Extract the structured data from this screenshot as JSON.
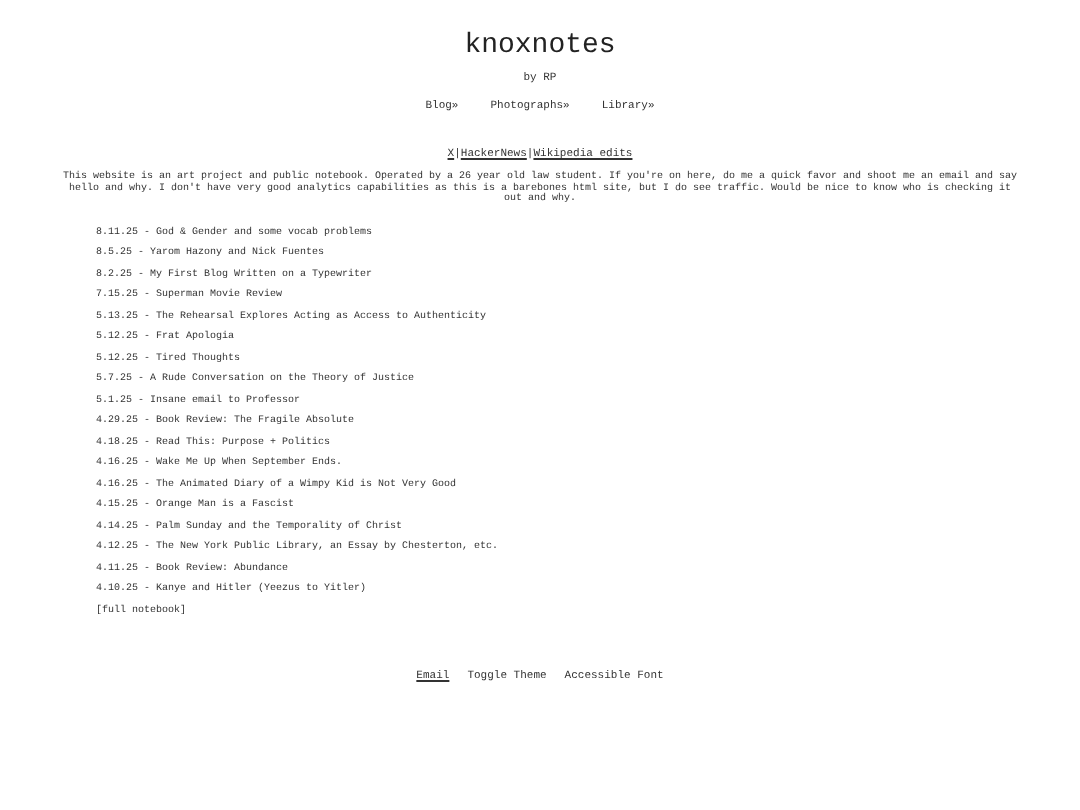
{
  "site": {
    "title": "knoxnotes",
    "byline": "by RP"
  },
  "nav": [
    "Blog»",
    "Photographs»",
    "Library»"
  ],
  "social_links": [
    {
      "kind": "link",
      "text": "X"
    },
    {
      "kind": "separator",
      "text": "|"
    },
    {
      "kind": "link",
      "text": "HackerNews"
    },
    {
      "kind": "separator",
      "text": "|"
    },
    {
      "kind": "link",
      "text": "Wikipedia edits"
    }
  ],
  "intro": "This website is an art project and public notebook. Operated by a 26 year old law student. If you're on here, do me a quick favor and shoot me an email and say hello and why. I don't have very good analytics capabilities as this is a barebones html site, but I do see traffic. Would be nice to know who is checking it out and why.",
  "posts": [
    "8.11.25 - God & Gender and some vocab problems",
    "8.5.25 - Yarom Hazony and Nick Fuentes",
    "8.2.25 - My First Blog Written on a Typewriter",
    "7.15.25 - Superman Movie Review",
    "5.13.25 - The Rehearsal Explores Acting as Access to Authenticity",
    "5.12.25 - Frat Apologia",
    "5.12.25 - Tired Thoughts",
    "5.7.25 - A Rude Conversation on the Theory of Justice",
    "5.1.25 - Insane email to Professor",
    "4.29.25 - Book Review: The Fragile Absolute",
    "4.18.25 - Read This: Purpose + Politics",
    "4.16.25 - Wake Me Up When September Ends.",
    "4.16.25 - The Animated Diary of a Wimpy Kid is Not Very Good",
    "4.15.25 - Orange Man is a Fascist",
    "4.14.25 - Palm Sunday and the Temporality of Christ",
    "4.12.25 - The New York Public Library, an Essay by Chesterton, etc.",
    "4.11.25 - Book Review: Abundance",
    "4.10.25 - Kanye and Hitler (Yeezus to Yitler)"
  ],
  "full_notebook": "[full notebook]",
  "footer": [
    {
      "label": "Email",
      "kind": "link"
    },
    {
      "label": "Toggle Theme",
      "kind": "plain"
    },
    {
      "label": "Accessible Font",
      "kind": "plain"
    }
  ]
}
